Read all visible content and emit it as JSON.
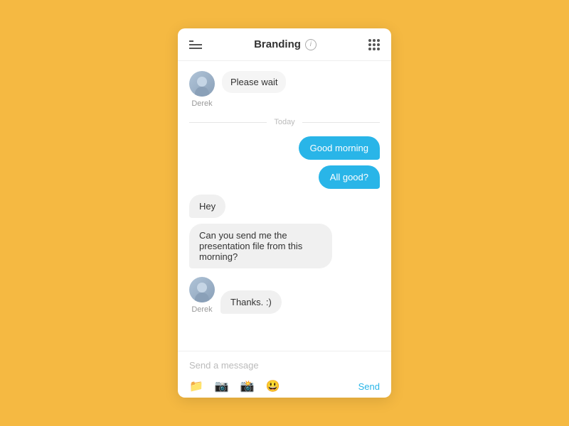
{
  "header": {
    "title": "Branding",
    "info_label": "i"
  },
  "status_message": {
    "text": "Please wait",
    "sender": "Derek"
  },
  "date_divider": "Today",
  "messages": [
    {
      "id": 1,
      "type": "sent",
      "text": "Good morning"
    },
    {
      "id": 2,
      "type": "sent",
      "text": "All good?"
    },
    {
      "id": 3,
      "type": "received",
      "text": "Hey"
    },
    {
      "id": 4,
      "type": "received",
      "text": "Can you send me the presentation file from this morning?"
    },
    {
      "id": 5,
      "type": "received_avatar",
      "text": "Thanks. :)",
      "sender": "Derek"
    }
  ],
  "input": {
    "placeholder": "Send a message"
  },
  "toolbar": {
    "send_label": "Send"
  }
}
